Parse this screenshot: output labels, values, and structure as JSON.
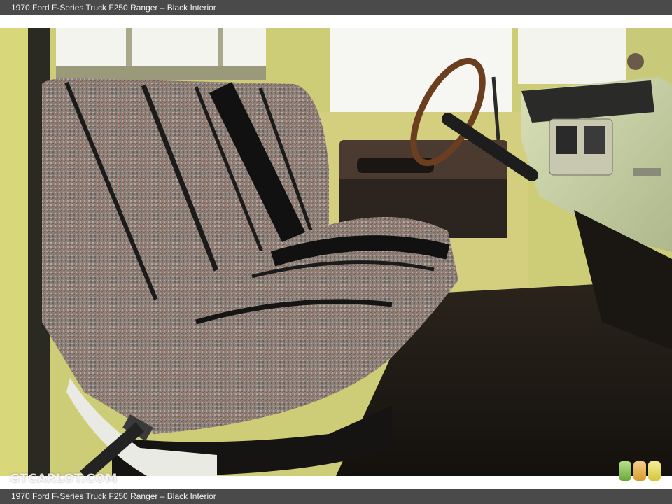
{
  "caption": {
    "top": "1970 Ford F-Series Truck F250 Ranger – Black Interior",
    "bottom": "1970 Ford F-Series Truck F250 Ranger – Black Interior"
  },
  "watermark": "GTCARLOT.COM",
  "colors": {
    "caption_bg": "#4a4a4a",
    "body_paint": "#cfcf7a",
    "seat_fabric": "#8a7e78",
    "seat_stripe": "#1b1b1b",
    "floor": "#1c1712"
  }
}
